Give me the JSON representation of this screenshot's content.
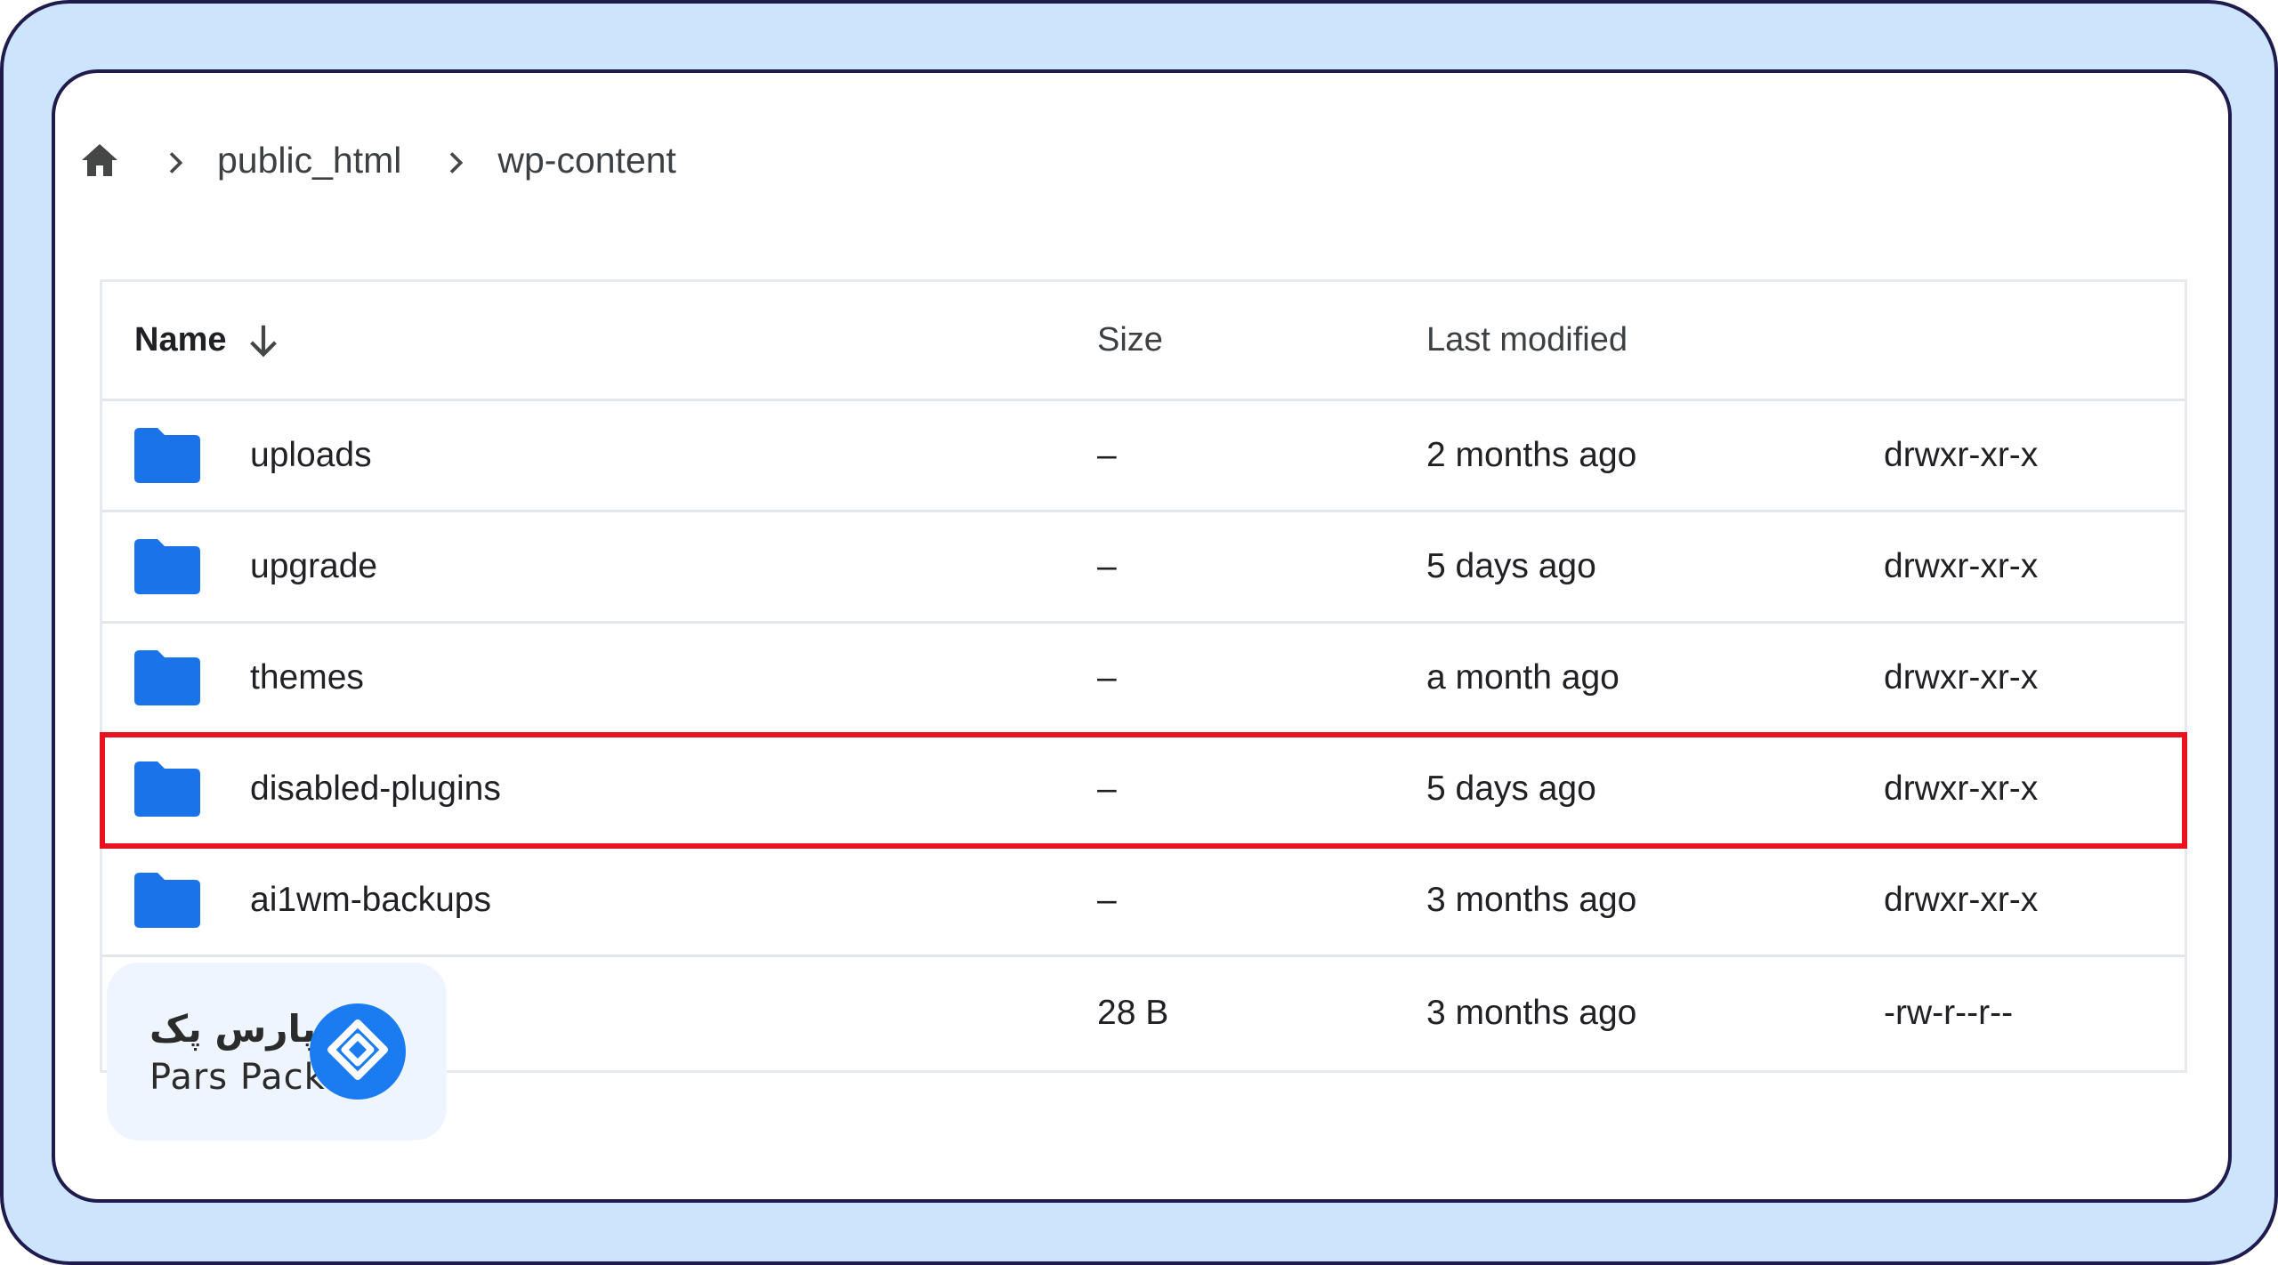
{
  "colors": {
    "frame_bg": "#cde4fd",
    "frame_border": "#1f1b4d",
    "folder": "#1a73e8",
    "highlight": "#e8131e",
    "logo_blue": "#1a7cf0"
  },
  "breadcrumb": {
    "home_icon": "home-icon",
    "items": [
      "public_html",
      "wp-content"
    ]
  },
  "table": {
    "columns": {
      "name": "Name",
      "size": "Size",
      "last_modified": "Last modified"
    },
    "sort_icon": "arrow-down-icon",
    "rows": [
      {
        "name": "uploads",
        "size": "–",
        "modified": "2 months ago",
        "perm": "drwxr-xr-x",
        "type": "folder"
      },
      {
        "name": "upgrade",
        "size": "–",
        "modified": "5 days ago",
        "perm": "drwxr-xr-x",
        "type": "folder"
      },
      {
        "name": "themes",
        "size": "–",
        "modified": "a month ago",
        "perm": "drwxr-xr-x",
        "type": "folder"
      },
      {
        "name": "disabled-plugins",
        "size": "–",
        "modified": "5 days ago",
        "perm": "drwxr-xr-x",
        "type": "folder",
        "highlighted": true
      },
      {
        "name": "ai1wm-backups",
        "size": "–",
        "modified": "3 months ago",
        "perm": "drwxr-xr-x",
        "type": "folder"
      },
      {
        "name": "",
        "size": "28 B",
        "modified": "3 months ago",
        "perm": "-rw-r--r--",
        "type": "file"
      }
    ]
  },
  "logo": {
    "text_fa": "پارس پک",
    "text_en": "Pars Pack"
  }
}
